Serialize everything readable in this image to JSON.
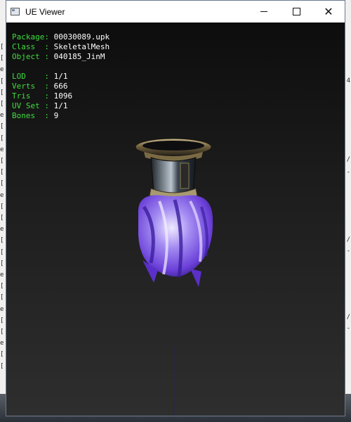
{
  "window": {
    "title": "UE Viewer"
  },
  "info_block_1": [
    {
      "key": "Package",
      "sep": ": ",
      "value": "00030089.upk",
      "pad": ""
    },
    {
      "key": "Class",
      "sep": "  : ",
      "value": "SkeletalMesh",
      "pad": ""
    },
    {
      "key": "Object",
      "sep": " : ",
      "value": "040185_JinM",
      "pad": ""
    }
  ],
  "info_block_2": [
    {
      "key": "LOD",
      "sep": "    : ",
      "value": "1/1"
    },
    {
      "key": "Verts",
      "sep": "  : ",
      "value": "666"
    },
    {
      "key": "Tris",
      "sep": "   : ",
      "value": "1096"
    },
    {
      "key": "UV Set",
      "sep": " : ",
      "value": "1/1"
    },
    {
      "key": "Bones",
      "sep": "  : ",
      "value": "9"
    }
  ],
  "colors": {
    "key": "#3fdc3f",
    "value": "#ffffff",
    "axis": "#1a1aa8",
    "mesh_primary": "#8a6cf0"
  },
  "background_left_glyphs": [
    "[",
    "[",
    "e",
    "[",
    "[",
    "[",
    "e",
    "[",
    "[",
    "e",
    "[",
    "[",
    "[",
    "e",
    "[",
    "[",
    "e",
    "[",
    "[",
    "[",
    "e",
    "[",
    "[",
    "e",
    "[",
    "[",
    "e",
    "[",
    "["
  ],
  "background_right_glyphs": [
    "4",
    "/",
    "-",
    "/",
    "-",
    "/",
    "-"
  ]
}
